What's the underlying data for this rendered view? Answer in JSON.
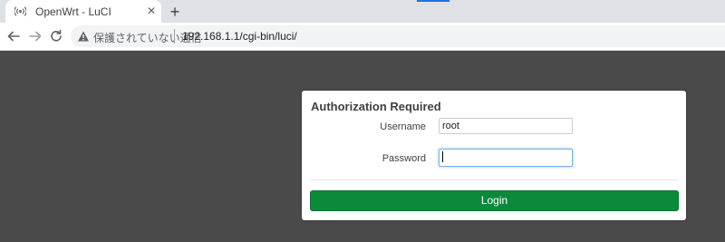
{
  "browser": {
    "tab": {
      "title": "OpenWrt - LuCI",
      "favicon": "wireless-antenna-icon",
      "close_glyph": "✕"
    },
    "new_tab_glyph": "+",
    "toolbar": {
      "back_icon": "back-arrow-icon",
      "forward_icon": "forward-arrow-icon",
      "reload_icon": "reload-icon"
    },
    "omnibox": {
      "security_icon": "warning-triangle-icon",
      "security_text": "保護されていない通信",
      "url": "192.168.1.1/cgi-bin/luci/"
    }
  },
  "page": {
    "background": "#4a4a4a",
    "login": {
      "title": "Authorization Required",
      "username_label": "Username",
      "username_value": "root",
      "password_label": "Password",
      "password_value": "",
      "button_label": "Login",
      "button_color": "#0b8a3b"
    }
  }
}
